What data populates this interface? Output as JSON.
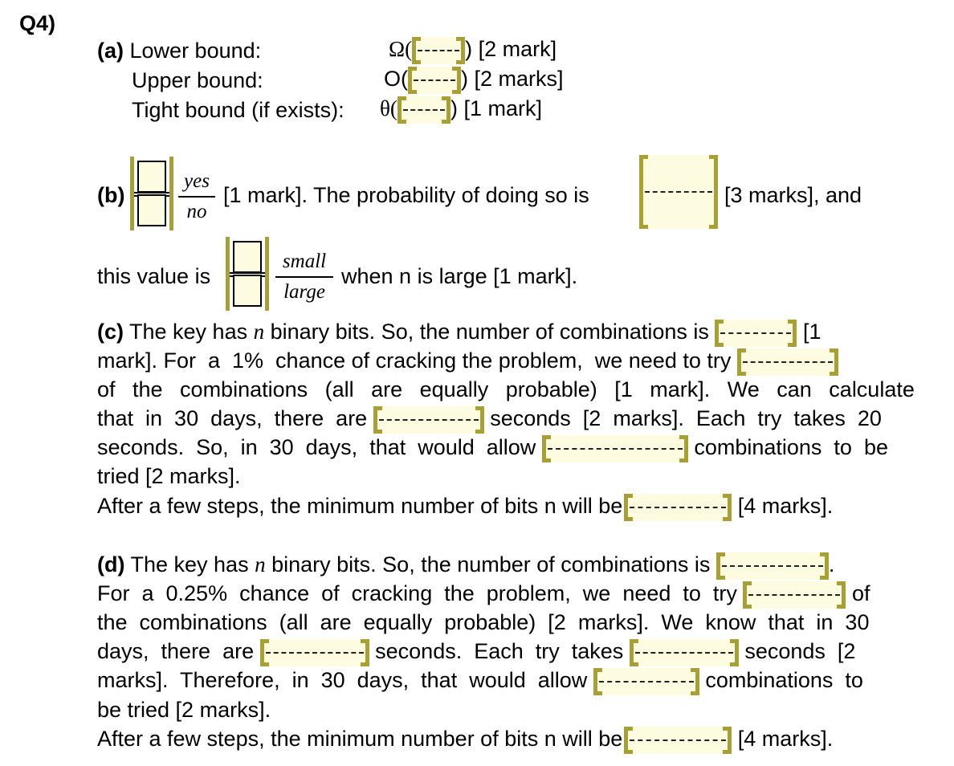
{
  "question_label": "Q4)",
  "part_a": {
    "label": "(a)",
    "rows": [
      {
        "label": "Lower bound:",
        "symbol": "Ω(",
        "close": ")",
        "marks": "[2 mark]",
        "field": "-------"
      },
      {
        "label": "Upper bound:",
        "symbol": "O(",
        "close": ")",
        "marks": "[2 marks]",
        "field": "-------"
      },
      {
        "label": "Tight bound (if exists):",
        "symbol": "θ(",
        "close": ")",
        "marks": "[1 mark]",
        "field": "-------"
      }
    ]
  },
  "part_b": {
    "label": "(b)",
    "choice1": {
      "top": "yes",
      "bottom": "no"
    },
    "text1": "[1 mark]. The probability of doing so is",
    "field1": "----------",
    "text2": "[3 marks], and",
    "text3": "this value is",
    "choice2": {
      "top": "small",
      "bottom": "large"
    },
    "text4": "when n is large [1 mark]."
  },
  "part_c": {
    "label": "(c)",
    "l1a": "The key has",
    "n": "n",
    "l1b": "binary bits. So, the number of combinations is",
    "l1c": "[1",
    "l2a": "mark]. For  a  1%  chance of cracking the problem,  we need to try",
    "l3": [
      "of",
      "the",
      "combinations",
      "(all",
      "are",
      "equally",
      "probable)",
      "[1",
      "mark].",
      "We",
      "can",
      "calculate"
    ],
    "l4a": "that  in  30  days,  there  are",
    "l4b": "seconds  [2  marks].  Each  try  takes  20",
    "l5a": "seconds.  So,  in  30  days,  that  would  allow",
    "l5b": "combinations  to  be",
    "l6": "tried [2 marks].",
    "l7a": "After a few steps, the minimum number of bits n will be",
    "l7b": "[4 marks].",
    "fields": [
      "-----------",
      "------------",
      "-------------",
      "----------------",
      "-------------"
    ]
  },
  "part_d": {
    "label": "(d)",
    "l1a": "The key has",
    "n": "n",
    "l1b": "binary bits. So, the number of combinations is",
    "l1c": ".",
    "l2a": "For  a  0.25%  chance  of  cracking  the  problem,  we  need  to  try",
    "l2b": "of",
    "l3": "the  combinations  (all  are  equally  probable)  [2  marks].  We  know  that  in  30",
    "l4a": "days,  there  are",
    "l4b": "seconds.  Each  try  takes",
    "l4c": "seconds  [2",
    "l5a": "marks].  Therefore,  in  30  days,  that  would  allow",
    "l5b": "combinations  to",
    "l6": "be tried [2 marks].",
    "l7a": "After a few steps, the minimum number of bits n will be",
    "l7b": "[4 marks].",
    "fields": [
      "--------------",
      "------------",
      "-------------",
      "-------------",
      "------------",
      "-------------"
    ]
  },
  "colors": {
    "field_fill": "#fefce0",
    "field_bracket": "#a89f35"
  }
}
